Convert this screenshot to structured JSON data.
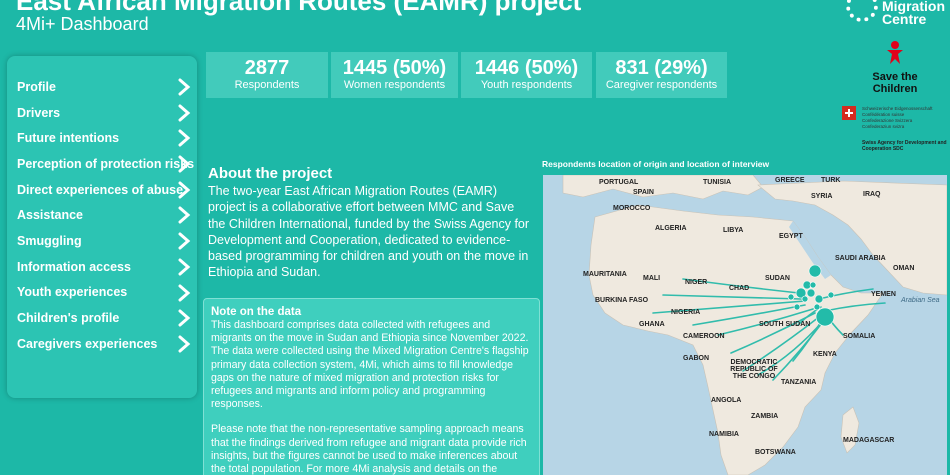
{
  "header": {
    "title": "East African Migration Routes (EAMR) project",
    "subtitle": "4Mi+ Dashboard"
  },
  "logos": {
    "mmc": "Migration Centre",
    "stc": "Save the Children",
    "swiss_lines": [
      "Schweizerische Eidgenossenschaft",
      "Confédération suisse",
      "Confederazione Svizzera",
      "Confederaziun svizra"
    ],
    "swiss_agency": "Swiss Agency for Development and Cooperation SDC"
  },
  "sidebar": {
    "items": [
      {
        "label": "Profile"
      },
      {
        "label": "Drivers"
      },
      {
        "label": "Future intentions"
      },
      {
        "label": "Perception of protection risks"
      },
      {
        "label": "Direct experiences of abuse"
      },
      {
        "label": "Assistance"
      },
      {
        "label": "Smuggling"
      },
      {
        "label": "Information access"
      },
      {
        "label": "Youth experiences"
      },
      {
        "label": "Children's profile"
      },
      {
        "label": "Caregivers experiences"
      }
    ]
  },
  "stats": [
    {
      "value": "2877",
      "label": "Respondents"
    },
    {
      "value": "1445  (50%)",
      "label": "Women respondents"
    },
    {
      "value": "1446  (50%)",
      "label": "Youth respondents"
    },
    {
      "value": "831  (29%)",
      "label": "Caregiver respondents"
    }
  ],
  "about": {
    "title": "About the project",
    "body": "The two-year East African Migration Routes (EAMR) project is a collaborative effort between MMC and Save the Children International, funded by the Swiss Agency for Development and Cooperation, dedicated to evidence-based programming for children and youth on the move in Ethiopia and Sudan."
  },
  "note": {
    "title": "Note on the data",
    "p1": "This dashboard comprises data collected with refugees and migrants on the move in Sudan and Ethiopia since November 2022. The data were collected using the Mixed Migration Centre's flagship primary data collection system, 4Mi, which aims to fill knowledge gaps on the nature of mixed migration and protection risks for refugees and migrants and inform policy and programming responses.",
    "p2": "Please note that the non-representative sampling approach means that the findings derived from refugee and migrant data provide rich insights, but the figures cannot be used to make inferences about the total population. For more 4Mi analysis and details on the"
  },
  "map": {
    "title": "Respondents location of origin and location of interview",
    "labels": [
      "PORTUGAL",
      "SPAIN",
      "TUNISIA",
      "GREECE",
      "TURK",
      "SYRIA",
      "IRAQ",
      "MOROCCO",
      "ALGERIA",
      "LIBYA",
      "EGYPT",
      "SAUDI ARABIA",
      "OMAN",
      "MAURITANIA",
      "MALI",
      "NIGER",
      "CHAD",
      "SUDAN",
      "YEMEN",
      "BURKINA FASO",
      "NIGERIA",
      "GHANA",
      "CAMEROON",
      "GABON",
      "SOUTH SUDAN",
      "SOMALIA",
      "KENYA",
      "DEMOCRATIC REPUBLIC OF THE CONGO",
      "TANZANIA",
      "ANGOLA",
      "ZAMBIA",
      "NAMIBIA",
      "BOTSWANA",
      "MADAGASCAR",
      "Arabian Sea"
    ],
    "colors": {
      "land": "#efe9df",
      "sea": "#b7d5e6",
      "flow": "#1db8a7"
    }
  }
}
